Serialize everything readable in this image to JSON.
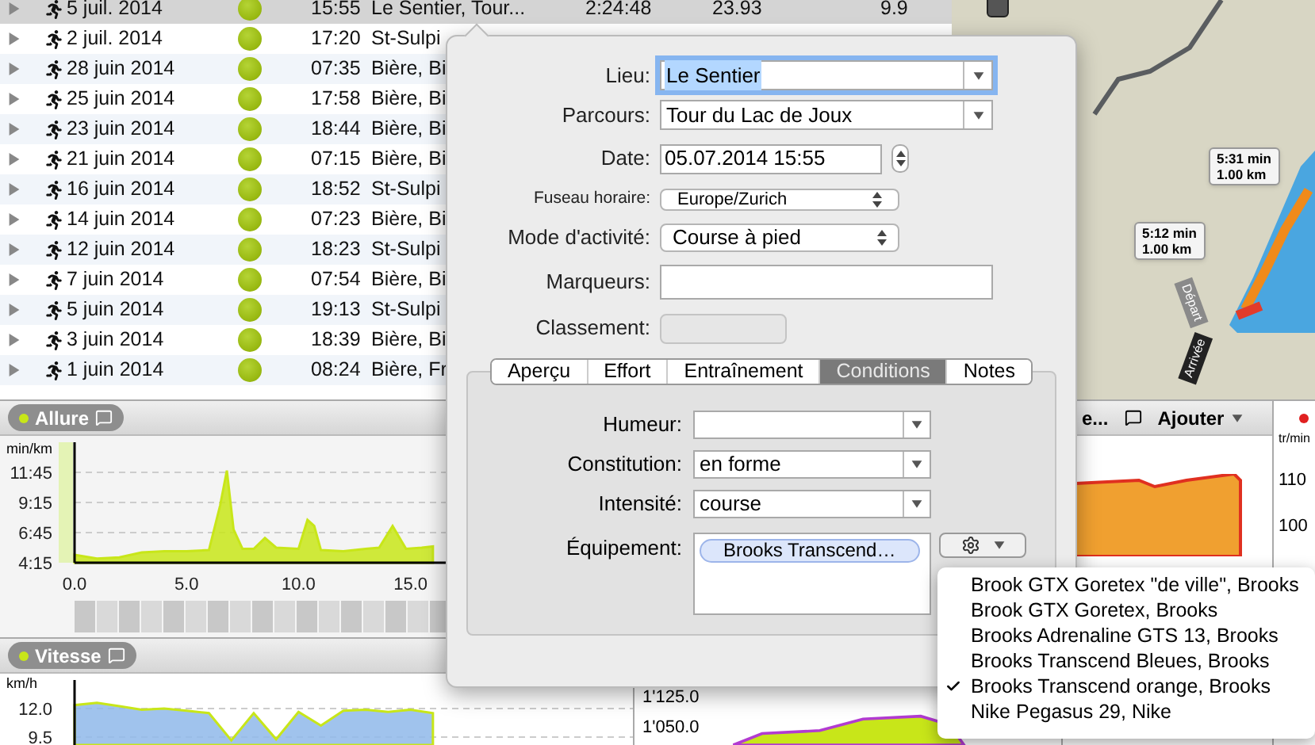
{
  "activities": [
    {
      "date": "5 juil. 2014",
      "time": "15:55",
      "location": "Le Sentier, Tour...",
      "duration": "2:24:48",
      "distance": "23.93",
      "speed": "9.9",
      "selected": true
    },
    {
      "date": "2 juil. 2014",
      "time": "17:20",
      "location": "St-Sulpi",
      "selected": false
    },
    {
      "date": "28 juin 2014",
      "time": "07:35",
      "location": "Bière, Bi",
      "selected": false
    },
    {
      "date": "25 juin 2014",
      "time": "17:58",
      "location": "Bière, Bi",
      "selected": false
    },
    {
      "date": "23 juin 2014",
      "time": "18:44",
      "location": "Bière, Bi",
      "selected": false
    },
    {
      "date": "21 juin 2014",
      "time": "07:15",
      "location": "Bière, Bi",
      "selected": false
    },
    {
      "date": "16 juin 2014",
      "time": "18:52",
      "location": "St-Sulpi",
      "selected": false
    },
    {
      "date": "14 juin 2014",
      "time": "07:23",
      "location": "Bière, Bi",
      "selected": false
    },
    {
      "date": "12 juin 2014",
      "time": "18:23",
      "location": "St-Sulpi",
      "selected": false
    },
    {
      "date": "7 juin 2014",
      "time": "07:54",
      "location": "Bière, Bi",
      "selected": false
    },
    {
      "date": "5 juin 2014",
      "time": "19:13",
      "location": "St-Sulpi",
      "selected": false
    },
    {
      "date": "3 juin 2014",
      "time": "18:39",
      "location": "Bière, Bi",
      "selected": false
    },
    {
      "date": "1 juin 2014",
      "time": "08:24",
      "location": "Bière, Fr",
      "selected": false
    }
  ],
  "map": {
    "markers": [
      {
        "time": "5:31 min",
        "distance": "1.00 km"
      },
      {
        "time": "5:12 min",
        "distance": "1.00 km"
      }
    ],
    "start_label": "Départ",
    "finish_label": "Arrivée"
  },
  "allure": {
    "chart_data": {
      "type": "area",
      "title": "Allure",
      "ylabel": "min/km",
      "grid": true,
      "x": [
        0,
        1,
        2,
        3,
        4,
        5,
        6,
        6.5,
        6.8,
        7.1,
        7.5,
        8,
        8.5,
        9,
        10,
        10.4,
        10.7,
        11,
        12,
        13,
        13.6,
        14.2,
        14.8,
        15.5,
        16
      ],
      "series": [
        {
          "color": "#c8e619",
          "values": [
            4.9,
            4.6,
            4.7,
            5.1,
            5.2,
            5.2,
            5.3,
            9,
            11.9,
            7,
            5.4,
            5.4,
            6.3,
            5.5,
            5.4,
            7.8,
            7.3,
            5.3,
            5.2,
            5.4,
            5.5,
            7.3,
            5.4,
            5.5,
            5.6
          ]
        }
      ],
      "xlim": [
        0,
        25
      ],
      "ylim": [
        4.25,
        14.25
      ],
      "xticks": [
        {
          "value": 0,
          "label": "0.0"
        },
        {
          "value": 5,
          "label": "5.0"
        },
        {
          "value": 10,
          "label": "10.0"
        },
        {
          "value": 15,
          "label": "15.0"
        }
      ],
      "yticks": [
        {
          "value": 4.25,
          "label": "4:15"
        },
        {
          "value": 6.75,
          "label": "6:45"
        },
        {
          "value": 9.25,
          "label": "9:15"
        },
        {
          "value": 11.75,
          "label": "11:45"
        }
      ]
    }
  },
  "vitesse": {
    "chart_data": {
      "type": "area",
      "title": "Vitesse",
      "ylabel": "km/h",
      "grid": true,
      "series": [
        {
          "color": "#8fb8ea",
          "values": [
            12.3,
            12.5,
            12.2,
            11.9,
            12.0,
            11.8,
            11.6,
            9.2,
            11.6,
            9.3,
            11.7,
            10.5,
            11.8,
            11.9,
            11.7,
            11.9,
            11.6
          ]
        }
      ],
      "ylim": [
        8.8,
        14.5
      ],
      "yticks": [
        {
          "value": 12,
          "label": "12.0"
        },
        {
          "value": 9.5,
          "label": "9.5"
        }
      ]
    }
  },
  "altitude_panel": {
    "ticks": [
      "1'125.0",
      "1'050.0"
    ]
  },
  "side_panel": {
    "title": "e...",
    "button": "Ajouter"
  },
  "cadence_panel": {
    "unit": "tr/min",
    "ticks": [
      "110",
      "100"
    ]
  },
  "editor": {
    "fields": [
      {
        "kind": "combo",
        "label": "Lieu:",
        "value": "Le Sentier",
        "focused": true
      },
      {
        "kind": "combo",
        "label": "Parcours:",
        "value": "Tour du Lac de Joux",
        "focused": false
      },
      {
        "kind": "date",
        "label": "Date:",
        "value": "05.07.2014 15:55"
      },
      {
        "kind": "small_popup",
        "label": "Fuseau horaire:",
        "value": "Europe/Zurich"
      },
      {
        "kind": "popup",
        "label": "Mode d'activité:",
        "value": "Course à pied"
      },
      {
        "kind": "text",
        "label": "Marqueurs:"
      },
      {
        "kind": "disabled",
        "label": "Classement:"
      }
    ],
    "tabs": [
      {
        "label": "Aperçu",
        "selected": false
      },
      {
        "label": "Effort",
        "selected": false
      },
      {
        "label": "Entraînement",
        "selected": false
      },
      {
        "label": "Conditions",
        "selected": true
      },
      {
        "label": "Notes",
        "selected": false
      }
    ],
    "conditions": [
      {
        "label": "Humeur:"
      },
      {
        "label": "Constitution:",
        "value": "en forme"
      },
      {
        "label": "Intensité:",
        "value": "course"
      }
    ],
    "equipment": {
      "label": "Équipement:",
      "tokens": [
        "Brooks Transcend…"
      ]
    }
  },
  "equipment_menu": [
    {
      "label": "Brook GTX Goretex \"de ville\", Brooks",
      "checked": false
    },
    {
      "label": "Brook GTX Goretex, Brooks",
      "checked": false
    },
    {
      "label": "Brooks Adrenaline GTS 13, Brooks",
      "checked": false
    },
    {
      "label": "Brooks Transcend Bleues, Brooks",
      "checked": false
    },
    {
      "label": "Brooks Transcend orange, Brooks",
      "checked": true
    },
    {
      "label": "Nike Pegasus 29, Nike",
      "checked": false
    }
  ]
}
